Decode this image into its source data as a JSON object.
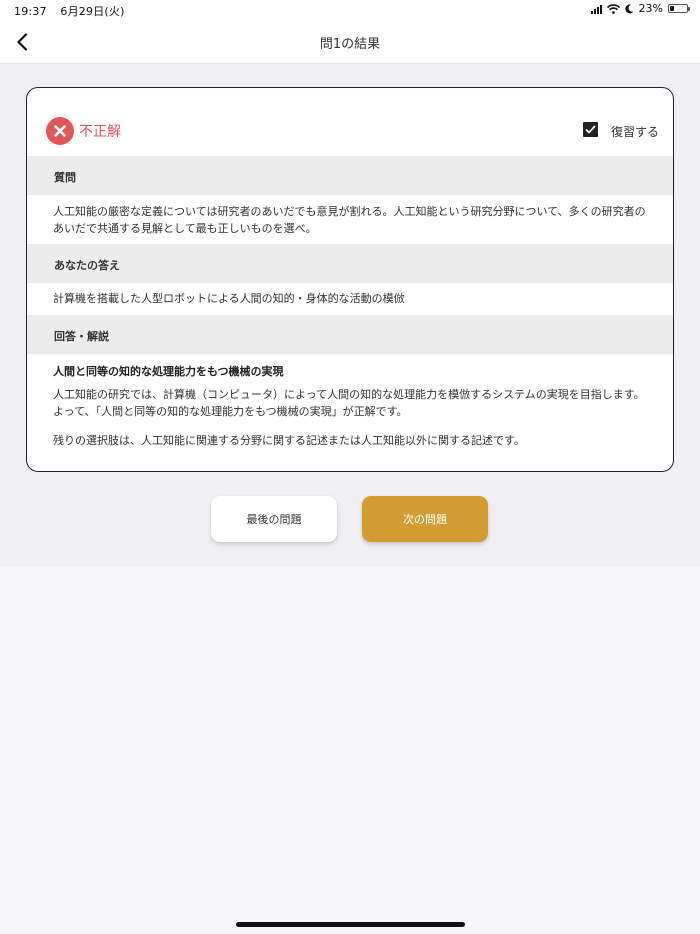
{
  "status_bar": {
    "time": "19:37",
    "date": "6月29日(火)",
    "battery_percent": "23%",
    "battery_level": 0.23
  },
  "nav": {
    "title": "問1の結果"
  },
  "result": {
    "label": "不正解",
    "review_label": "復習する",
    "review_checked": true
  },
  "sections": {
    "question": {
      "header": "質問",
      "text": "人工知能の厳密な定義については研究者のあいだでも意見が割れる。人工知能という研究分野について、多くの研究者のあいだで共通する見解として最も正しいものを選べ。"
    },
    "your_answer": {
      "header": "あなたの答え",
      "text": "計算機を搭載した人型ロボットによる人間の知的・身体的な活動の模倣"
    },
    "explanation": {
      "header": "回答・解説",
      "title": "人間と同等の知的な処理能力をもつ機械の実現",
      "paragraph1": "人工知能の研究では、計算機（コンピュータ）によって人間の知的な処理能力を模倣するシステムの実現を目指します。よって、「人間と同等の知的な処理能力をもつ機械の実現」が正解です。",
      "paragraph2": "残りの選択肢は、人工知能に関連する分野に関する記述または人工知能以外に関する記述です。"
    }
  },
  "buttons": {
    "last_question": "最後の問題",
    "next_question": "次の問題"
  },
  "colors": {
    "incorrect": "#e05656",
    "accent": "#d39c32"
  },
  "icons": [
    "back-chevron-icon",
    "signal-icon",
    "wifi-icon",
    "moon-icon",
    "battery-icon",
    "incorrect-x-icon",
    "checkbox-checked-icon"
  ]
}
